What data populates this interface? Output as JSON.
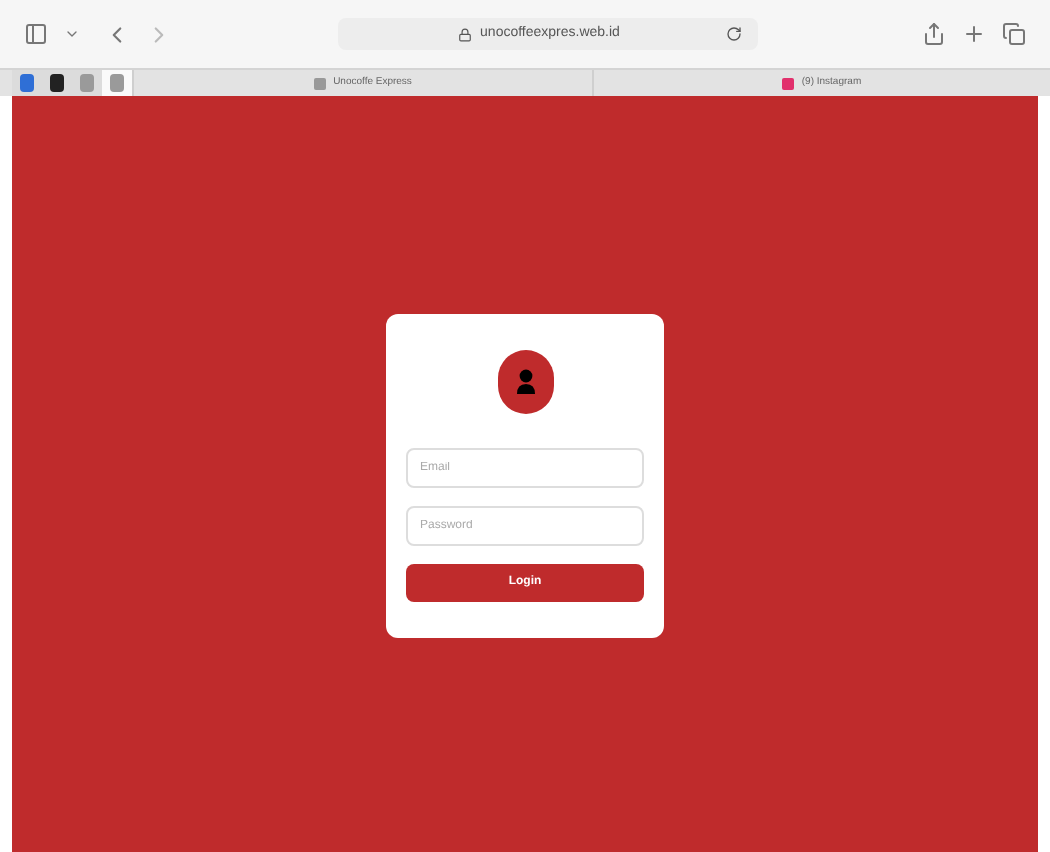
{
  "toolbar": {
    "address": "unocoffeexpres.web.id"
  },
  "tabs": [
    {
      "kind": "pinned",
      "selected": false
    },
    {
      "kind": "pinned",
      "selected": false
    },
    {
      "kind": "pinned",
      "selected": false
    },
    {
      "kind": "pinned",
      "selected": true
    },
    {
      "kind": "tab",
      "label": "Unocoffe Express",
      "selected": false
    },
    {
      "kind": "tab",
      "label": "(9) Instagram",
      "selected": false
    }
  ],
  "login": {
    "email": {
      "placeholder": "Email"
    },
    "password": {
      "placeholder": "Password"
    },
    "button": "Login"
  }
}
